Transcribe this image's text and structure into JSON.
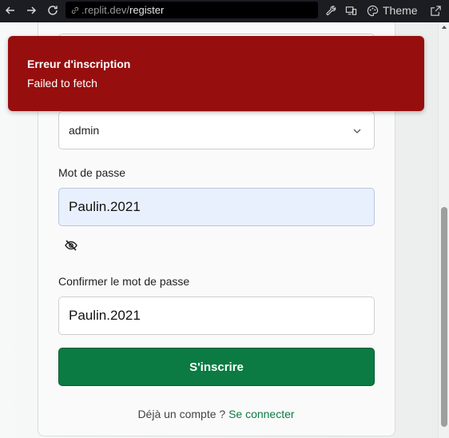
{
  "browser": {
    "url_prefix": ".replit.dev/",
    "url_path": "register",
    "theme_label": "Theme"
  },
  "form": {
    "role_value": "admin",
    "password_label": "Mot de passe",
    "password_value": "Paulin.2021",
    "confirm_label": "Confirmer le mot de passe",
    "confirm_value": "Paulin.2021",
    "submit_label": "S'inscrire",
    "login_prompt": "Déjà un compte ?",
    "login_link": "Se connecter"
  },
  "toast": {
    "title": "Erreur d'inscription",
    "message": "Failed to fetch",
    "color": "#970e0e"
  },
  "colors": {
    "accent": "#0b7a43"
  }
}
